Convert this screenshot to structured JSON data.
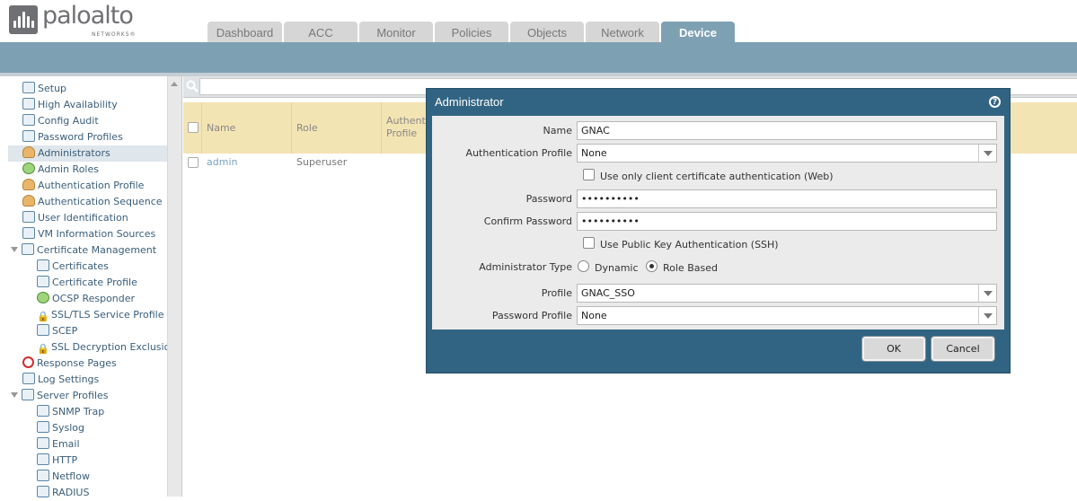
{
  "brand": {
    "name": "paloalto",
    "sub": "NETWORKS®"
  },
  "tabs": [
    {
      "label": "Dashboard",
      "active": false
    },
    {
      "label": "ACC",
      "active": false
    },
    {
      "label": "Monitor",
      "active": false
    },
    {
      "label": "Policies",
      "active": false
    },
    {
      "label": "Objects",
      "active": false
    },
    {
      "label": "Network",
      "active": false
    },
    {
      "label": "Device",
      "active": true
    }
  ],
  "sidebar": {
    "items": [
      {
        "label": "Setup",
        "icon": "setup-icon"
      },
      {
        "label": "High Availability",
        "icon": "high-availability-icon"
      },
      {
        "label": "Config Audit",
        "icon": "config-audit-icon"
      },
      {
        "label": "Password Profiles",
        "icon": "password-profiles-icon"
      },
      {
        "label": "Administrators",
        "icon": "administrators-icon",
        "selected": true
      },
      {
        "label": "Admin Roles",
        "icon": "admin-roles-icon"
      },
      {
        "label": "Authentication Profile",
        "icon": "authentication-profile-icon"
      },
      {
        "label": "Authentication Sequence",
        "icon": "authentication-sequence-icon"
      },
      {
        "label": "User Identification",
        "icon": "user-identification-icon"
      },
      {
        "label": "VM Information Sources",
        "icon": "vm-information-sources-icon"
      },
      {
        "label": "Certificate Management",
        "icon": "certificate-management-icon",
        "expanded": true
      },
      {
        "label": "Certificates",
        "icon": "certificates-icon",
        "child": true
      },
      {
        "label": "Certificate Profile",
        "icon": "certificate-profile-icon",
        "child": true
      },
      {
        "label": "OCSP Responder",
        "icon": "ocsp-responder-icon",
        "child": true
      },
      {
        "label": "SSL/TLS Service Profile",
        "icon": "lock-icon",
        "child": true
      },
      {
        "label": "SCEP",
        "icon": "scep-icon",
        "child": true
      },
      {
        "label": "SSL Decryption Exclusion",
        "icon": "lock-icon",
        "child": true
      },
      {
        "label": "Response Pages",
        "icon": "response-pages-icon"
      },
      {
        "label": "Log Settings",
        "icon": "log-settings-icon"
      },
      {
        "label": "Server Profiles",
        "icon": "server-profiles-icon",
        "expanded": true
      },
      {
        "label": "SNMP Trap",
        "icon": "snmp-trap-icon",
        "child": true
      },
      {
        "label": "Syslog",
        "icon": "syslog-icon",
        "child": true
      },
      {
        "label": "Email",
        "icon": "email-icon",
        "child": true
      },
      {
        "label": "HTTP",
        "icon": "http-icon",
        "child": true
      },
      {
        "label": "Netflow",
        "icon": "netflow-icon",
        "child": true
      },
      {
        "label": "RADIUS",
        "icon": "radius-icon",
        "child": true
      }
    ]
  },
  "grid": {
    "columns": [
      "Name",
      "Role",
      "Authentication Profile"
    ],
    "rows": [
      {
        "name": "admin",
        "role": "Superuser"
      }
    ]
  },
  "modal": {
    "title": "Administrator",
    "fields": {
      "name_label": "Name",
      "name_value": "GNAC",
      "auth_profile_label": "Authentication Profile",
      "auth_profile_value": "None",
      "client_cert_label": "Use only client certificate authentication (Web)",
      "password_label": "Password",
      "password_value": "••••••••••",
      "confirm_password_label": "Confirm Password",
      "confirm_password_value": "••••••••••",
      "public_key_label": "Use Public Key Authentication (SSH)",
      "admin_type_label": "Administrator Type",
      "admin_type_options": [
        "Dynamic",
        "Role Based"
      ],
      "admin_type_selected": "Role Based",
      "profile_label": "Profile",
      "profile_value": "GNAC_SSO",
      "password_profile_label": "Password Profile",
      "password_profile_value": "None"
    },
    "ok_label": "OK",
    "cancel_label": "Cancel"
  },
  "colors": {
    "header_bar": "#7ea0b3",
    "active_tab": "#7ea0b3",
    "modal_frame": "#316482",
    "grid_header": "#f3e4b3",
    "nav_text": "#3a5e7a"
  }
}
